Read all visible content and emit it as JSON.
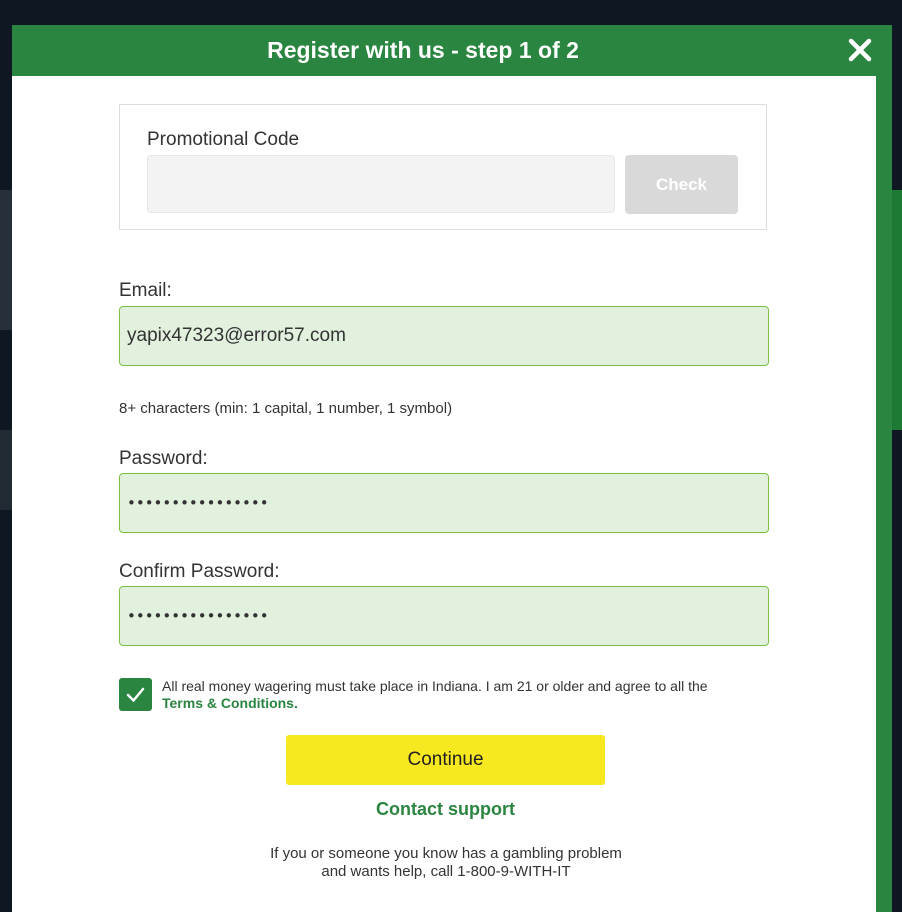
{
  "modal": {
    "title": "Register with us - step 1 of 2",
    "close_icon": "close-icon"
  },
  "promo": {
    "label": "Promotional Code",
    "value": "",
    "check_label": "Check"
  },
  "email": {
    "label": "Email:",
    "value": "yapix47323@error57.com"
  },
  "password_hint": "8+ characters (min: 1 capital, 1 number, 1 symbol)",
  "password": {
    "label": "Password:",
    "masked_value": "••••••••••••••••"
  },
  "confirm_password": {
    "label": "Confirm Password:",
    "masked_value": "••••••••••••••••"
  },
  "terms": {
    "checked": true,
    "text": "All real money wagering must take place in Indiana. I am 21 or older and agree to all the ",
    "link_label": "Terms & Conditions."
  },
  "continue_label": "Continue",
  "contact_support_label": "Contact support",
  "help": {
    "line1": "If you or someone you know has a gambling problem",
    "line2": "and wants help, call 1-800-9-WITH-IT"
  },
  "colors": {
    "brand_green": "#2a8540",
    "input_valid_bg": "#e2f0de",
    "input_valid_border": "#7cc242",
    "continue_yellow": "#f8e820",
    "check_disabled": "#d9d9d9"
  }
}
